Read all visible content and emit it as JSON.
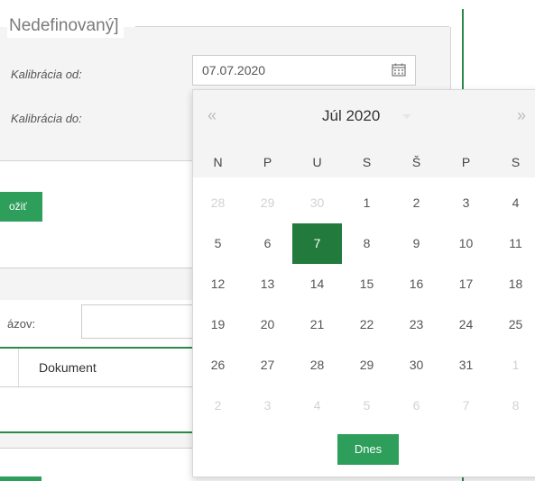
{
  "form": {
    "legend": "Nedefinovaný]",
    "label_from": "Kalibrácia od:",
    "label_to": "Kalibrácia do:",
    "date_from_value": "07.07.2020",
    "apply_button": "ožiť",
    "filter_label": "ázov:",
    "column_header": "Dokument"
  },
  "datepicker": {
    "prev": "«",
    "next": "»",
    "month_title": "Júl 2020",
    "weekdays": [
      "N",
      "P",
      "U",
      "S",
      "Š",
      "P",
      "S"
    ],
    "weeks": [
      [
        "28",
        "29",
        "30",
        "1",
        "2",
        "3",
        "4"
      ],
      [
        "5",
        "6",
        "7",
        "8",
        "9",
        "10",
        "11"
      ],
      [
        "12",
        "13",
        "14",
        "15",
        "16",
        "17",
        "18"
      ],
      [
        "19",
        "20",
        "21",
        "22",
        "23",
        "24",
        "25"
      ],
      [
        "26",
        "27",
        "28",
        "29",
        "30",
        "31",
        "1"
      ],
      [
        "2",
        "3",
        "4",
        "5",
        "6",
        "7",
        "8"
      ]
    ],
    "today_button": "Dnes"
  },
  "colors": {
    "accent_green": "#2e9e5b",
    "selected_day": "#237a3d"
  },
  "icons": {
    "date_input_icon": "calendar-icon"
  }
}
